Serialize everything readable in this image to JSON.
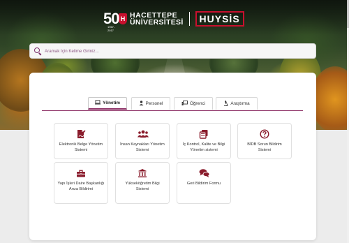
{
  "header": {
    "logo_number": "50",
    "logo_years": "1967-2017",
    "logo_shield": "H",
    "university_line1": "HACETTEPE",
    "university_line2": "ÜNİVERSİTESİ",
    "app_name": "HUYSİS"
  },
  "search": {
    "placeholder": "Aramak İçin Kelime Giriniz..."
  },
  "tabs": [
    {
      "label": "Yönetim",
      "icon": "laptop-icon",
      "active": true
    },
    {
      "label": "Personel",
      "icon": "person-icon",
      "active": false
    },
    {
      "label": "Öğrenci",
      "icon": "chalkboard-icon",
      "active": false
    },
    {
      "label": "Araştırma",
      "icon": "microscope-icon",
      "active": false
    }
  ],
  "tiles": [
    {
      "label": "Elektronik Belge Yönetim Sistemi",
      "icon": "file-signature-icon"
    },
    {
      "label": "İnsan Kaynakları Yönetim Sistemi",
      "icon": "users-icon"
    },
    {
      "label": "İç Kontrol, Kalite ve Bilgi Yönetim sistemi",
      "icon": "copy-icon"
    },
    {
      "label": "BİDB Sorun Bildirim Sistemi",
      "icon": "question-circle-icon"
    },
    {
      "label": "Yapı İşleri Daire Başkanlığı Arıza Bildirimi",
      "icon": "toolbox-icon"
    },
    {
      "label": "Yükseköğretim Bilgi Sistemi",
      "icon": "university-icon"
    },
    {
      "label": "Geri Bildirim Formu",
      "icon": "comments-icon"
    }
  ],
  "colors": {
    "accent": "#8a2b62",
    "icon": "#8a1c2c",
    "brand_red": "#c8102e"
  }
}
